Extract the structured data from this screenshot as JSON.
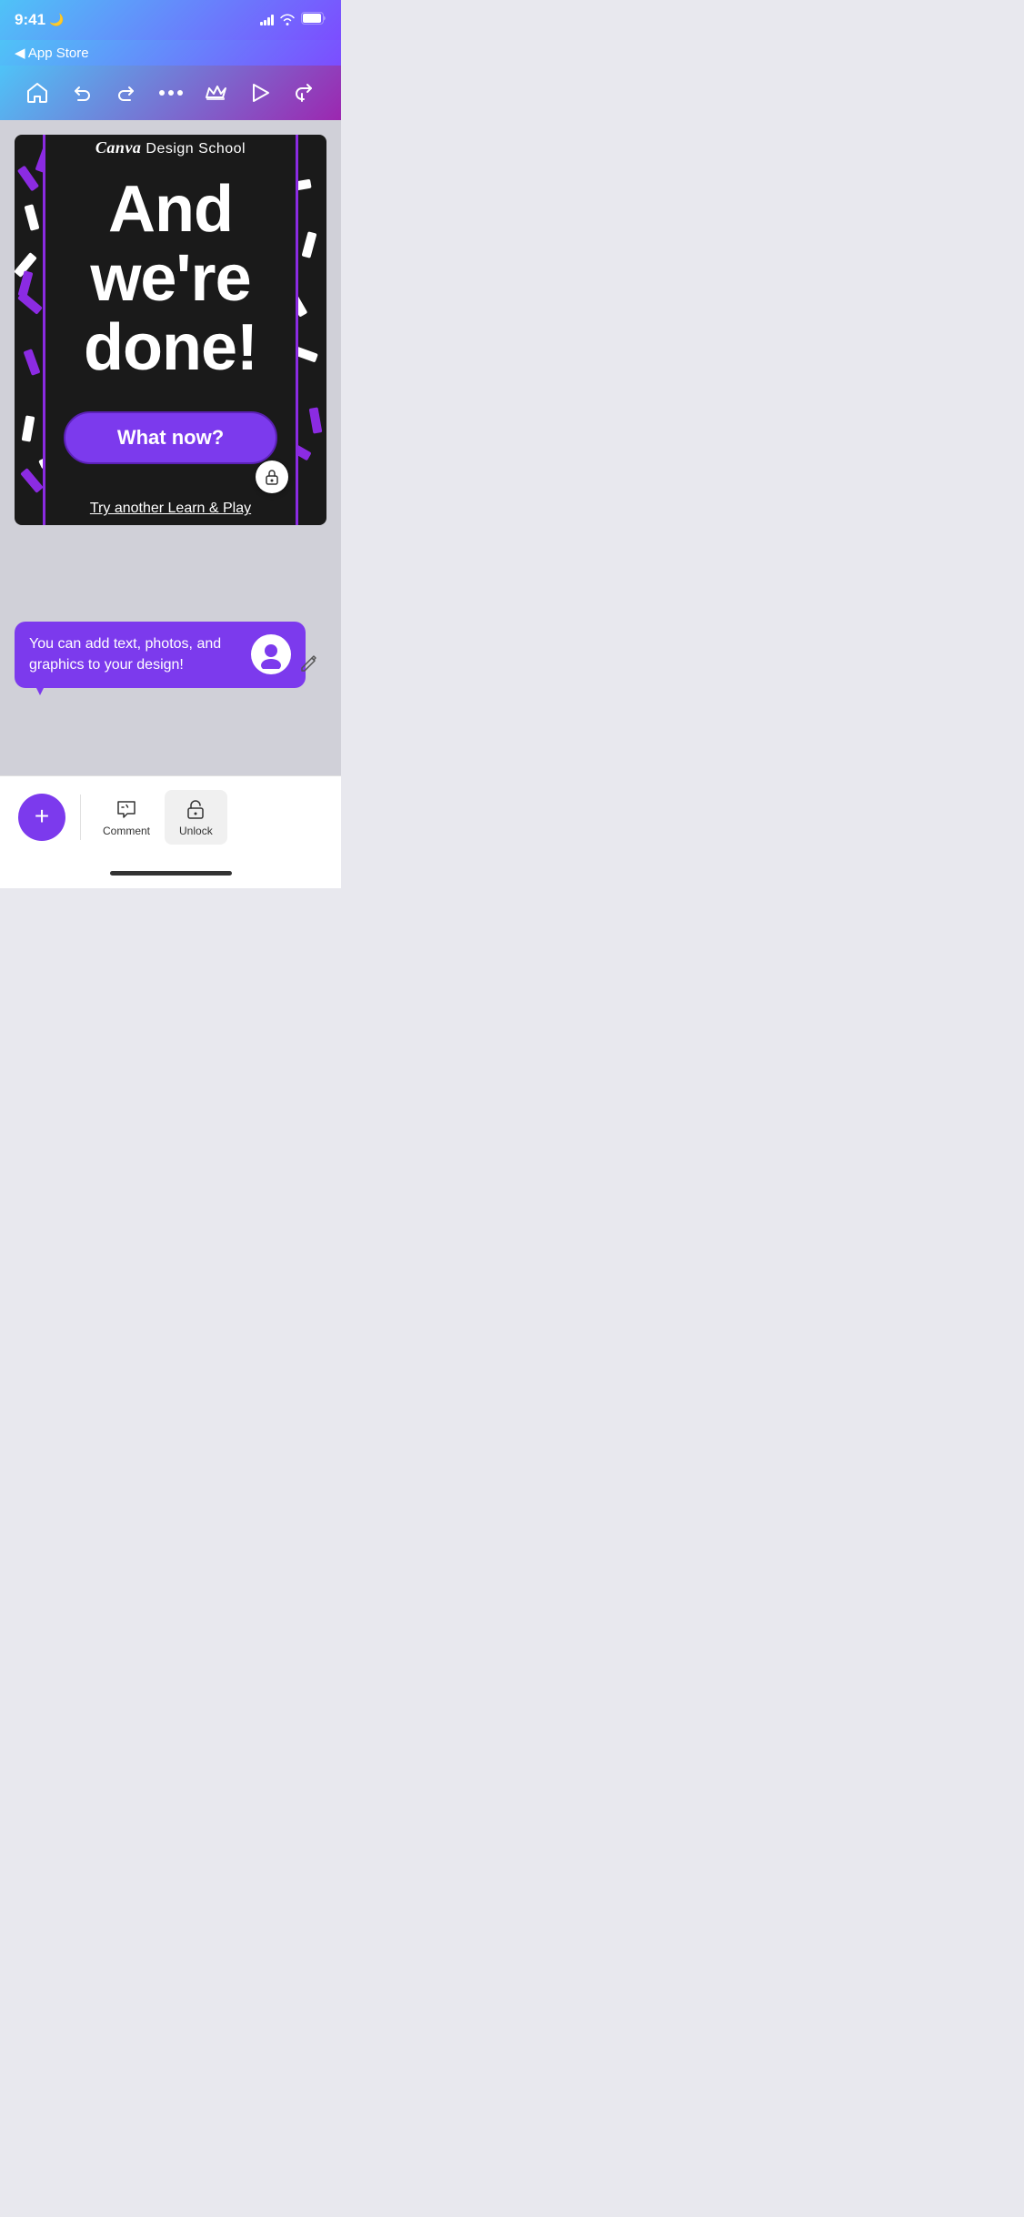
{
  "statusBar": {
    "time": "9:41",
    "moonIcon": "🌙",
    "backLabel": "◀ App Store"
  },
  "toolbar": {
    "homeIcon": "home-icon",
    "undoIcon": "undo-icon",
    "redoIcon": "redo-icon",
    "moreIcon": "more-options-icon",
    "crownIcon": "crown-icon",
    "playIcon": "play-icon",
    "shareIcon": "share-icon"
  },
  "designCanvas": {
    "brandName": "Design School",
    "brandScript": "Canva",
    "mainText": "And we're done!",
    "whatNowLabel": "What now?",
    "tryAnotherLabel": "Try another Learn & Play"
  },
  "tooltip": {
    "text": "You can add text, photos, and graphics to your design!"
  },
  "bottomBar": {
    "addIcon": "+",
    "commentLabel": "Comment",
    "unlockLabel": "Unlock"
  },
  "colors": {
    "purple": "#7c3aed",
    "gradientStart": "#4fc3f7",
    "gradientEnd": "#9c27b0",
    "canvasBackground": "#1a1a1a"
  }
}
